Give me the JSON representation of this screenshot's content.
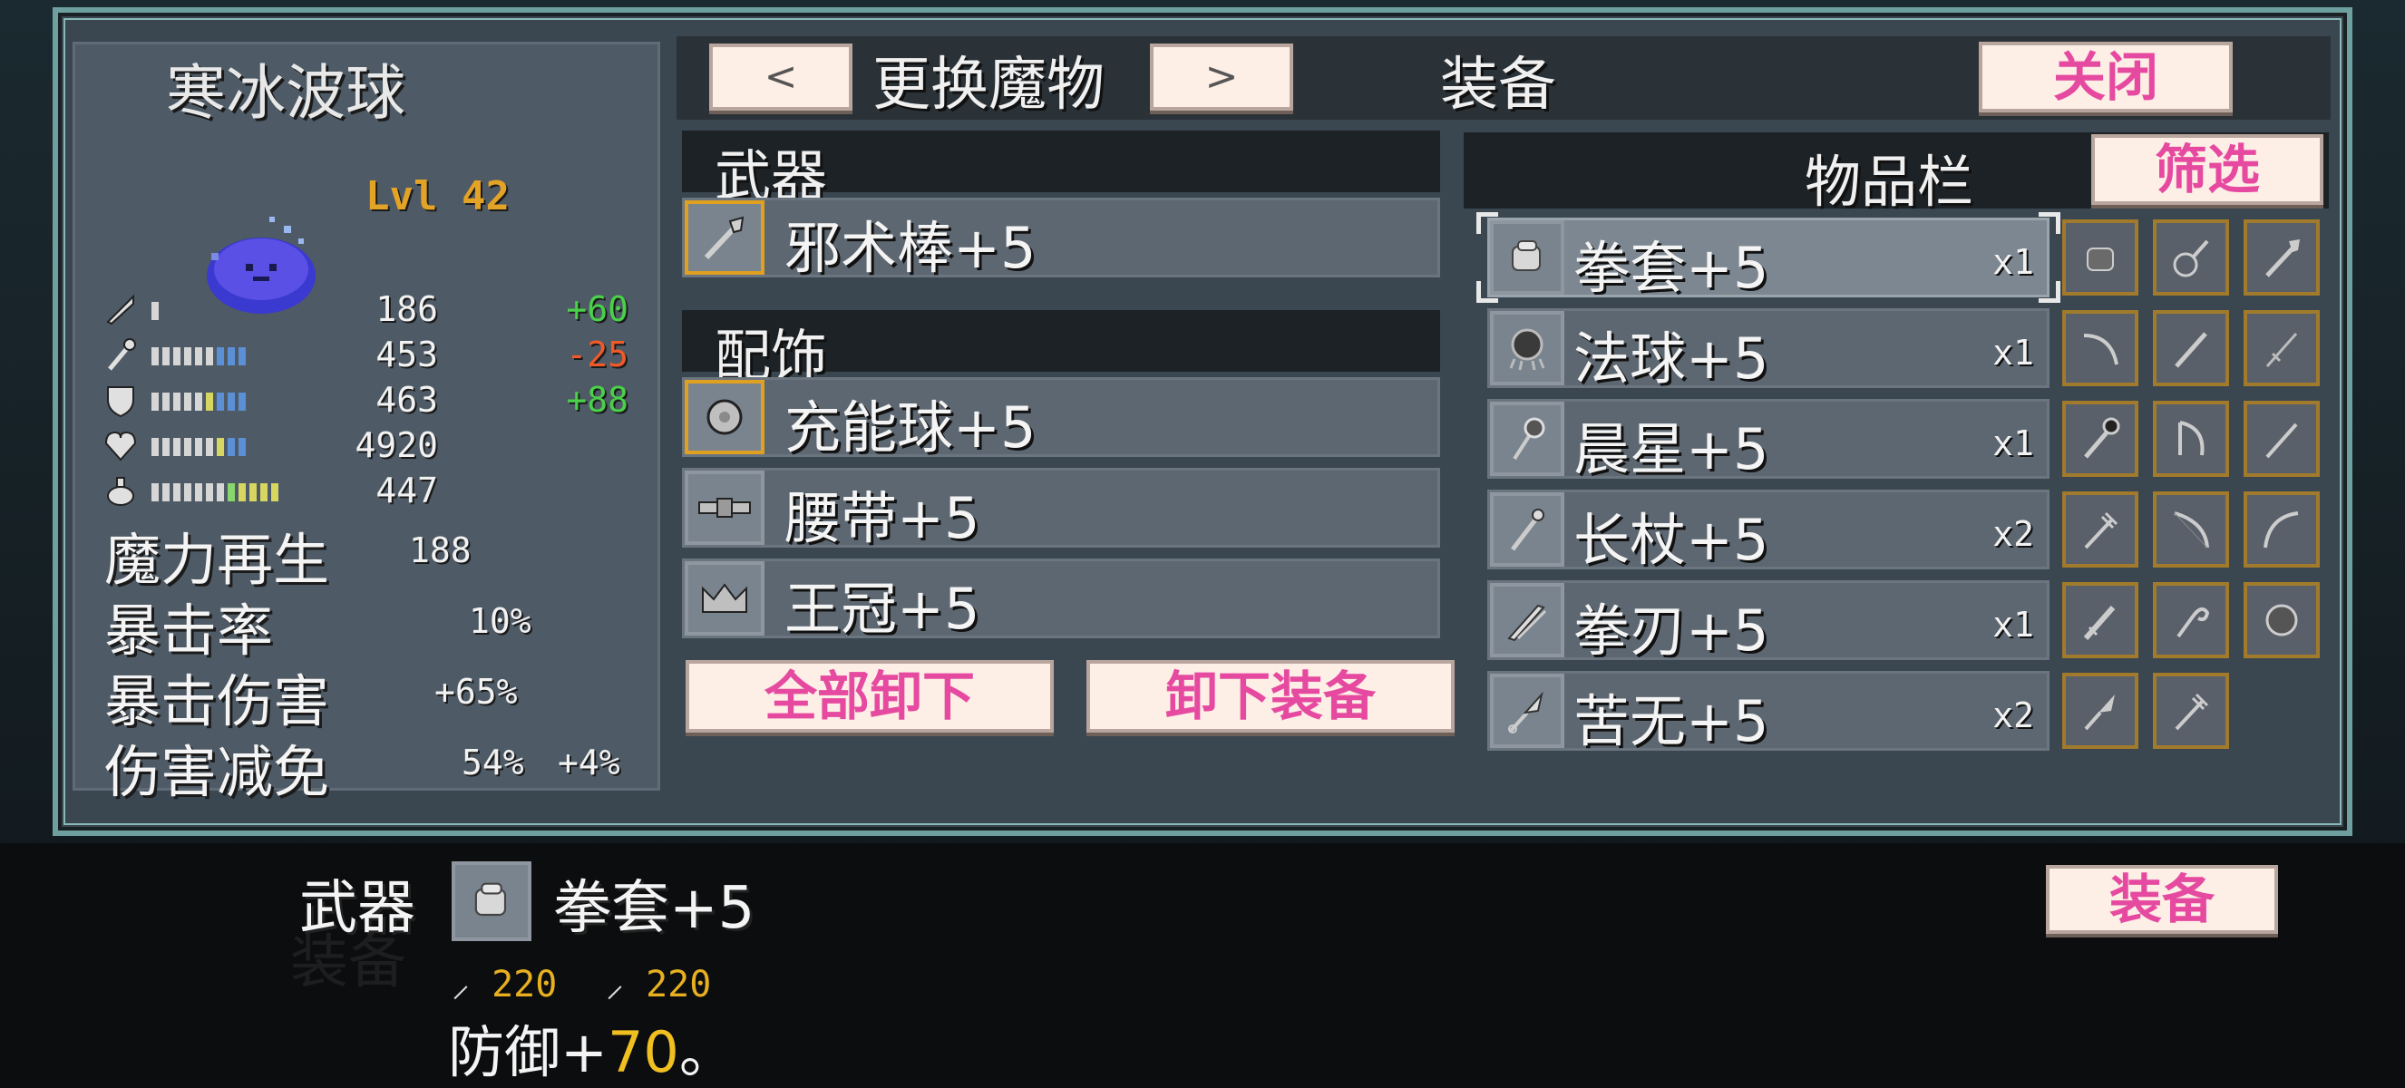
{
  "monster": {
    "name": "寒冰波球",
    "level": "Lvl 42"
  },
  "stats": [
    {
      "icon": "sword-icon",
      "value": "186",
      "delta": "+60",
      "delta_type": "pos"
    },
    {
      "icon": "staff-icon",
      "value": "453",
      "delta": "-25",
      "delta_type": "neg"
    },
    {
      "icon": "shield-icon",
      "value": "463",
      "delta": "+88",
      "delta_type": "pos"
    },
    {
      "icon": "heart-icon",
      "value": "4920",
      "delta": "",
      "delta_type": ""
    },
    {
      "icon": "potion-icon",
      "value": "447",
      "delta": "",
      "delta_type": ""
    }
  ],
  "attributes": [
    {
      "label": "魔力再生",
      "value": "188",
      "delta": ""
    },
    {
      "label": "暴击率",
      "value": "10%",
      "delta": ""
    },
    {
      "label": "暴击伤害",
      "value": "+65%",
      "delta": ""
    },
    {
      "label": "伤害减免",
      "value": "54%",
      "delta": "+4%"
    }
  ],
  "header": {
    "prev_label": "<",
    "next_label": ">",
    "change_monster": "更换魔物",
    "equipment_title": "装备",
    "close_label": "关闭"
  },
  "equipment": {
    "weapon_header": "武器",
    "weapon": "邪术棒+5",
    "accessory_header": "配饰",
    "accessories": [
      "充能球+5",
      "腰带+5",
      "王冠+5"
    ],
    "unequip_all": "全部卸下",
    "unequip": "卸下装备"
  },
  "inventory": {
    "title": "物品栏",
    "filter_label": "筛选",
    "items": [
      {
        "name": "拳套+5",
        "qty": "x1",
        "icon": "gauntlet-icon"
      },
      {
        "name": "法球+5",
        "qty": "x1",
        "icon": "orb-icon"
      },
      {
        "name": "晨星+5",
        "qty": "x1",
        "icon": "morningstar-icon"
      },
      {
        "name": "长杖+5",
        "qty": "x2",
        "icon": "staff-icon"
      },
      {
        "name": "拳刃+5",
        "qty": "x1",
        "icon": "katar-icon"
      },
      {
        "name": "苦无+5",
        "qty": "x2",
        "icon": "kunai-icon"
      }
    ],
    "grid_icons": [
      "gauntlet-icon",
      "lute-icon",
      "scepter-icon",
      "bow-icon",
      "staff-icon",
      "sword-icon",
      "mace-icon",
      "harp-icon",
      "wand-icon",
      "trident-icon",
      "longbow-icon",
      "recurve-bow-icon",
      "dagger-icon",
      "hook-icon",
      "orb-icon",
      "kunai-icon",
      "trident-icon"
    ]
  },
  "detail": {
    "slot_label": "武器",
    "item_name": "拳套+5",
    "atk1": "220",
    "atk2": "220",
    "desc_prefix": "防御+",
    "desc_num": "70",
    "desc_suffix": "。",
    "equip_label": "装备"
  }
}
